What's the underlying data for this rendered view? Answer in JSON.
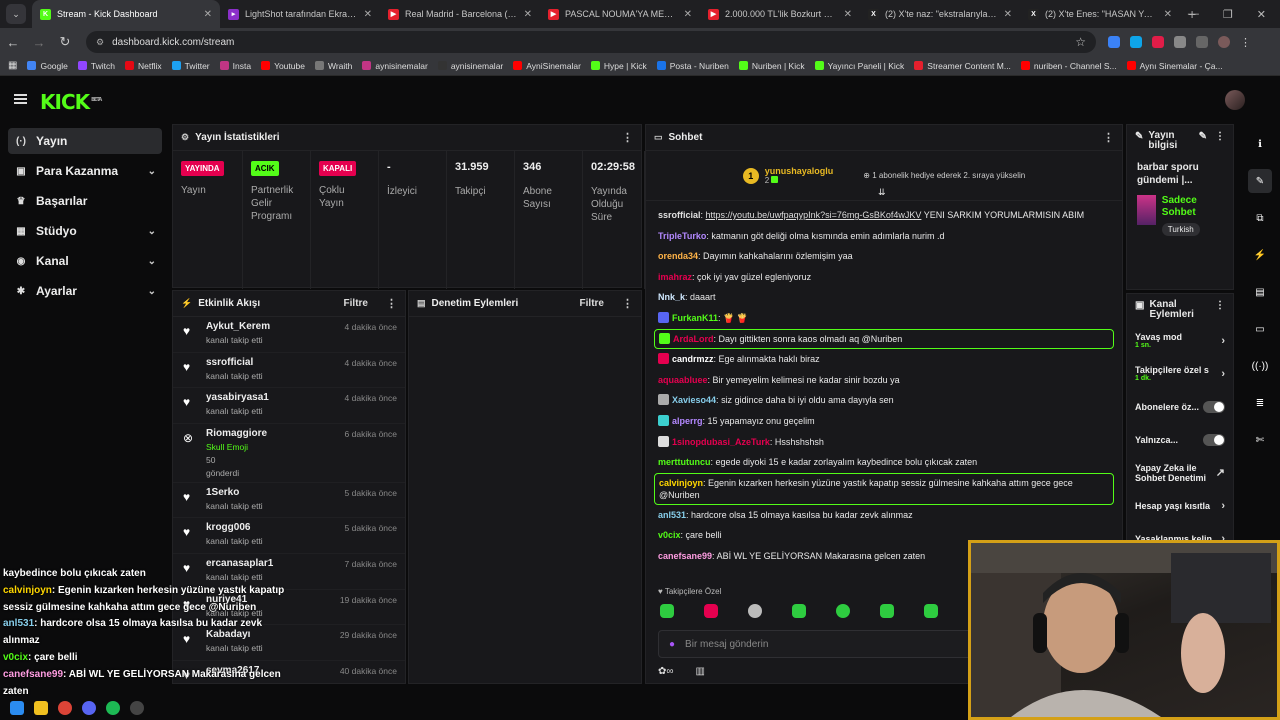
{
  "browser": {
    "tabs": [
      {
        "title": "Stream - Kick Dashboard",
        "color": "#53fc18",
        "active": true,
        "glyph": "K"
      },
      {
        "title": "LightShot tarafından Ekran Gör",
        "color": "#8b2fc9",
        "glyph": "▸"
      },
      {
        "title": "Real Madrid - Barcelona (2-1) -",
        "color": "#e5202d",
        "glyph": "▶"
      },
      {
        "title": "PASCAL NOUMA'YA MEYDAN O",
        "color": "#e5202d",
        "glyph": "▶"
      },
      {
        "title": "2.000.000 TL'lik Bozkurt Çiftliği",
        "color": "#e5202d",
        "glyph": "▶"
      },
      {
        "title": "(2) X'te naz: \"ekstralarıyla kopa",
        "color": "#222",
        "glyph": "X"
      },
      {
        "title": "(2) X'te Enes: \"HASAN YAYIND",
        "color": "#222",
        "glyph": "X"
      }
    ],
    "url": "dashboard.kick.com/stream",
    "bookmarks": [
      {
        "label": "Google",
        "color": "#4285f4"
      },
      {
        "label": "Twitch",
        "color": "#9146ff"
      },
      {
        "label": "Netflix",
        "color": "#e50914"
      },
      {
        "label": "Twitter",
        "color": "#1da1f2"
      },
      {
        "label": "Insta",
        "color": "#c13584"
      },
      {
        "label": "Youtube",
        "color": "#ff0000"
      },
      {
        "label": "Wraith",
        "color": "#777"
      },
      {
        "label": "aynisinemalar",
        "color": "#c13584"
      },
      {
        "label": "aynisinemalar",
        "color": "#333"
      },
      {
        "label": "AyniSinemalar",
        "color": "#ff0000"
      },
      {
        "label": "Hype | Kick",
        "color": "#53fc18"
      },
      {
        "label": "Posta - Nuriben",
        "color": "#1a73e8"
      },
      {
        "label": "Nuriben | Kick",
        "color": "#53fc18"
      },
      {
        "label": "Yayıncı Paneli | Kick",
        "color": "#53fc18"
      },
      {
        "label": "Streamer Content M...",
        "color": "#e5202d"
      },
      {
        "label": "nuriben - Channel S...",
        "color": "#ff0000"
      },
      {
        "label": "Aynı Sinemalar - Ça...",
        "color": "#ff0000"
      }
    ]
  },
  "logo": "KICK",
  "logo_beta": "BETA",
  "sidebar": [
    {
      "label": "Yayın",
      "icon": "(·)",
      "active": true,
      "chev": false
    },
    {
      "label": "Para Kazanma",
      "icon": "▣",
      "chev": true
    },
    {
      "label": "Başarılar",
      "icon": "♛",
      "chev": false
    },
    {
      "label": "Stüdyo",
      "icon": "▦",
      "chev": true
    },
    {
      "label": "Kanal",
      "icon": "◉",
      "chev": true
    },
    {
      "label": "Ayarlar",
      "icon": "✱",
      "chev": true
    }
  ],
  "stats": {
    "title": "Yayın İstatistikleri",
    "items": [
      {
        "badge": "YAYINDA",
        "badge_color": "#e5004f",
        "badge_text": "#fff",
        "label": "Yayın",
        "width": 70
      },
      {
        "badge": "ACIK",
        "badge_color": "#53fc18",
        "badge_text": "#000",
        "label": "Partnerlik Gelir Programı",
        "width": 68
      },
      {
        "badge": "KAPALI",
        "badge_color": "#e5004f",
        "badge_text": "#fff",
        "label": "Çoklu Yayın",
        "width": 68
      },
      {
        "num": "-",
        "label": "İzleyici",
        "width": 68
      },
      {
        "num": "31.959",
        "label": "Takipçi",
        "width": 68
      },
      {
        "num": "346",
        "label": "Abone Sayısı",
        "width": 68
      },
      {
        "num": "02:29:58",
        "label": "Yayında Olduğu Süre",
        "width": 62
      }
    ]
  },
  "activity": {
    "title": "Etkinlik Akışı",
    "filter": "Filtre",
    "items": [
      {
        "name": "Aykut_Kerem",
        "sub": "kanalı takip etti",
        "time": "4 dakika önce"
      },
      {
        "name": "ssrofficial",
        "sub": "kanalı takip etti",
        "time": "4 dakika önce"
      },
      {
        "name": "yasabiryasa1",
        "sub": "kanalı takip etti",
        "time": "4 dakika önce"
      },
      {
        "name": "Riomaggiore",
        "sub": "Skull Emoji",
        "sub2": "50",
        "sub3": "gönderdi",
        "time": "6 dakika önce",
        "gift": true
      },
      {
        "name": "1Serko",
        "sub": "kanalı takip etti",
        "time": "5 dakika önce"
      },
      {
        "name": "krogg006",
        "sub": "kanalı takip etti",
        "time": "5 dakika önce"
      },
      {
        "name": "ercanasaplar1",
        "sub": "kanalı takip etti",
        "time": "7 dakika önce"
      },
      {
        "name": "nuriye41",
        "sub": "kanalı takip etti",
        "time": "19 dakika önce"
      },
      {
        "name": "Kabadayı",
        "sub": "kanalı takip etti",
        "time": "29 dakika önce"
      },
      {
        "name": "sevma2617",
        "sub": "",
        "time": "40 dakika önce"
      }
    ]
  },
  "moderation": {
    "title": "Denetim Eylemleri",
    "filter": "Filtre"
  },
  "chat": {
    "title": "Sohbet",
    "pinned_user": "yunushayaloglu",
    "pinned_count": "2",
    "pinned_text": "1 abonelik hediye ederek 2. sıraya yükselin",
    "messages": [
      {
        "user": "ssrofficial",
        "color": "#e0e0e0",
        "text": "YENI SARKIM YORUMLARMISIN ABIM",
        "link": "https://youtu.be/uwfpaqypInk?si=76mg-GsBKof4wJKV"
      },
      {
        "user": "TripleTurko",
        "color": "#b388ff",
        "text": "katmanın göt deliği olma kısmında emin adımlarla nurim .d"
      },
      {
        "user": "orenda34",
        "color": "#ffb347",
        "text": "Dayımın kahkahalarını özlemişim yaa"
      },
      {
        "user": "imahraz",
        "color": "#e5004f",
        "text": "çok iyi yav güzel egleniyoruz"
      },
      {
        "user": "Nnk_k",
        "color": "#cfe8ff",
        "text": "daaart"
      },
      {
        "user": "FurkanK11",
        "color": "#53fc18",
        "text": "🍟 🍟",
        "badge": "#5865f2"
      },
      {
        "user": "ArdaLord",
        "color": "#e5004f",
        "text": "Dayı gittikten sonra kaos olmadı aq @Nuriben",
        "hl": true,
        "badge": "#53fc18"
      },
      {
        "user": "candrmzz",
        "color": "#ffffff",
        "text": "Ege alınmakta haklı biraz",
        "badge": "#e5004f"
      },
      {
        "user": "aquaabluee",
        "color": "#e5004f",
        "text": "Bir yemeyelim kelimesi ne kadar sinir bozdu ya"
      },
      {
        "user": "Xavieso44",
        "color": "#87ceeb",
        "text": "siz gidince daha bi iyi oldu ama dayıyla sen",
        "badge": "#aaa"
      },
      {
        "user": "alperrg",
        "color": "#b388ff",
        "text": "15 yapamayız onu geçelim",
        "badge": "#3ccfcf"
      },
      {
        "user": "1sinopdubasi_AzeTurk",
        "color": "#e5004f",
        "text": "Hsshshshsh",
        "badge": "#ddd"
      },
      {
        "user": "merttutuncu",
        "color": "#53fc18",
        "text": "egede diyoki 15 e kadar zorlayalım kaybedince bolu çıkıcak zaten"
      },
      {
        "user": "calvinjoyn",
        "color": "#ffd700",
        "text": "Egenin kızarken herkesin yüzüne yastık kapatıp sessiz gülmesine kahkaha attım gece gece @Nuriben",
        "hl": true
      },
      {
        "user": "anl531",
        "color": "#87ceeb",
        "text": "hardcore olsa 15 olmaya kasılsa bu kadar zevk alınmaz"
      },
      {
        "user": "v0cix",
        "color": "#53fc18",
        "text": "çare belli"
      },
      {
        "user": "canefsane99",
        "color": "#ff9de2",
        "text": "ABİ WL YE GELİYORSAN Makarasına gelcen zaten"
      }
    ],
    "followers_only": "Takipçilere Özel",
    "input_placeholder": "Bir mesaj gönderin"
  },
  "stream_info": {
    "title": "Yayın bilgisi",
    "desc": "barbar sporu gündemi |...",
    "tag": "Sadece Sohbet",
    "lang": "Turkish"
  },
  "channel_actions": {
    "title": "Kanal Eylemleri",
    "rows": [
      {
        "label": "Yavaş mod",
        "sub": "1 sn.",
        "type": "arrow"
      },
      {
        "label": "Takipçilere özel s",
        "sub": "1 dk.",
        "type": "arrow"
      },
      {
        "label": "Abonelere öz...",
        "type": "toggle"
      },
      {
        "label": "Yalnızca...",
        "type": "toggle"
      },
      {
        "label": "Yapay Zeka ile Sohbet Denetimi",
        "type": "ext"
      },
      {
        "label": "Hesap yaşı kısıtla",
        "type": "arrow"
      },
      {
        "label": "Yasaklanmış kelin",
        "type": "arrow"
      }
    ]
  },
  "right_icons": [
    {
      "name": "info-icon",
      "glyph": "ℹ",
      "bg": "transparent"
    },
    {
      "name": "edit-icon",
      "glyph": "✎",
      "bg": "#2a2b2e"
    },
    {
      "name": "layout-icon",
      "glyph": "⧉",
      "bg": "transparent"
    },
    {
      "name": "bolt-icon",
      "glyph": "⚡",
      "bg": "transparent"
    },
    {
      "name": "document-icon",
      "glyph": "▤",
      "bg": "transparent"
    },
    {
      "name": "chat-icon",
      "glyph": "▭",
      "bg": "transparent"
    },
    {
      "name": "broadcast-icon",
      "glyph": "((·))",
      "bg": "transparent"
    },
    {
      "name": "layers-icon",
      "glyph": "≣",
      "bg": "transparent"
    },
    {
      "name": "tool-icon",
      "glyph": "✄",
      "bg": "transparent"
    }
  ],
  "overlay_lines": [
    {
      "user": "",
      "text": "kaybedince bolu çıkıcak zaten"
    },
    {
      "user": "calvinjoyn",
      "color": "#ffd700",
      "text": ": Egenin kızarken herkesin yüzüne yastık kapatıp sessiz gülmesine kahkaha attım gece gece @Nuriben"
    },
    {
      "user": "anl531",
      "color": "#87ceeb",
      "text": ": hardcore olsa 15 olmaya kasılsa bu kadar zevk alınmaz"
    },
    {
      "user": "v0cix",
      "color": "#53fc18",
      "text": ": çare belli"
    },
    {
      "user": "canefsane99",
      "color": "#ff9de2",
      "text": ": ABİ WL YE GELİYORSAN Makarasına gelcen zaten"
    }
  ]
}
